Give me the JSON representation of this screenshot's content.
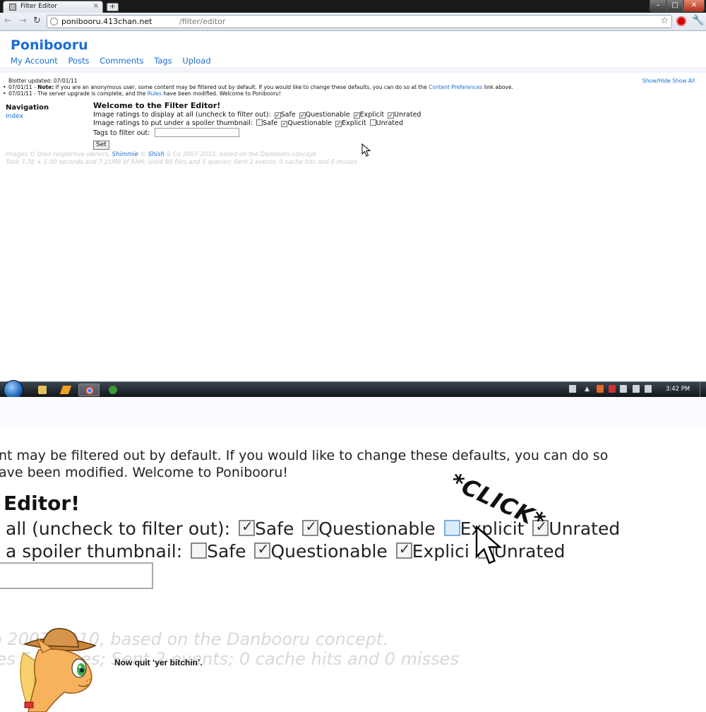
{
  "browser": {
    "tab_title": "Filter Editor",
    "tab_close": "×",
    "new_tab": "+",
    "url_host": "ponibooru.413chan.net",
    "url_path": "/filter/editor",
    "win_min": "–",
    "win_max": "□",
    "win_close": "✕"
  },
  "page": {
    "site_title": "Ponibooru",
    "nav": [
      "My Account",
      "Posts",
      "Comments",
      "Tags",
      "Upload"
    ],
    "blotter": {
      "updated": "Blotter updated: 07/01/11",
      "line1_date": "07/01/11 - ",
      "line1_note": "Note:",
      "line1_text": " If you are an anonymous user, some content may be filtered out by default. If you would like to change these defaults, you can do so at the ",
      "line1_link": "Content Preferences",
      "line1_end": " link above.",
      "line2_text": "07/01/11 - The server upgrade is complete, and the ",
      "line2_link": "Rules",
      "line2_end": " have been modified. Welcome to Ponibooru!",
      "show_hide": "Show/Hide Show All"
    },
    "navigation_head": "Navigation",
    "navigation_index": "Index",
    "filter": {
      "title": "Welcome to the Filter Editor!",
      "row1_label": "Image ratings to display at all (uncheck to filter out):",
      "row2_label": "Image ratings to put under a spoiler thumbnail:",
      "ratings": [
        "Safe",
        "Questionable",
        "Explicit",
        "Unrated"
      ],
      "tags_label": "Tags to filter out:",
      "set_button": "Set"
    },
    "footer": {
      "line1_a": "Images © their respective owners, ",
      "link1": "Shimmie",
      "line1_b": " © ",
      "link2": "Shish",
      "line1_c": " & Co 2007-2010, based on the Danbooru concept.",
      "line2": "Took 7.78 + 1.00 seconds and 7.21MB of RAM; Used 90 files and 5 queries; Sent 2 events; 0 cache hits and 0 misses"
    }
  },
  "taskbar": {
    "clock": "3:42 PM",
    "tray_up": "▲"
  },
  "zoom": {
    "line1": "nt may be filtered out by default. If you would like to change these defaults, you can do so",
    "line2": "ave been modified. Welcome to Ponibooru!",
    "title": "Editor!",
    "row1_label": "all (uncheck to filter out):",
    "row2_label": "a spoiler thumbnail:",
    "row1_ratings": [
      "Safe",
      "Questionable",
      "Explicit",
      "Unrated"
    ],
    "row2_ratings": [
      "Safe",
      "Questionable",
      "Explici",
      "Unrated"
    ],
    "footer1": "o 2007-2010, based on the Danbooru concept.",
    "footer2": "les 5 queries; Sent 2 events; 0 cache hits and 0 misses",
    "click": "*CLICK*",
    "caption": "Now quit ‘yer bitchin’."
  },
  "colors": {
    "link": "#1a6ecf",
    "footer_gray": "#c8c8c8"
  }
}
